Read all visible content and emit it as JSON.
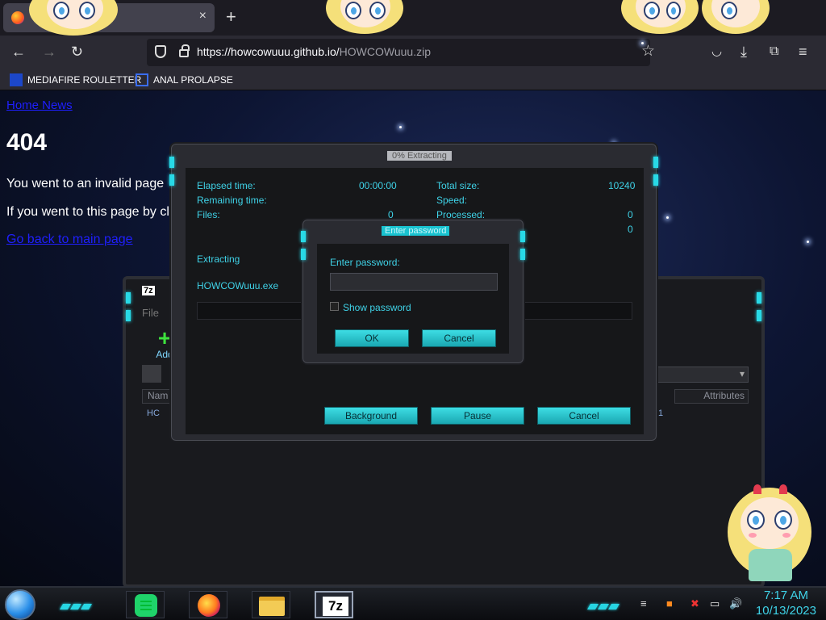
{
  "browser": {
    "tab_close": "×",
    "new_tab": "+",
    "url_main": "https://howcowuuu.github.io/",
    "url_path": "HOWCOWuuu.zip",
    "bookmarks": [
      {
        "label": "MEDIAFIRE ROULETTER",
        "icon_text": "MF\nT"
      },
      {
        "label": "ANAL PROLAPSE"
      }
    ]
  },
  "page": {
    "nav_link": "Home News",
    "heading": "404",
    "line1": "You went to an invalid page",
    "line2": "If you went to this page by cl",
    "back_link": "Go back to main page"
  },
  "file_manager": {
    "logo": "7z",
    "menu_file": "File",
    "add_label": "Add",
    "col_name": "Nam",
    "col_attributes": "Attributes",
    "row_prefix": "HC",
    "row_value": "1"
  },
  "progress": {
    "title": "0% Extracting",
    "elapsed_label": "Elapsed time:",
    "elapsed_value": "00:00:00",
    "remaining_label": "Remaining time:",
    "files_label": "Files:",
    "files_value": "0",
    "total_label": "Total size:",
    "total_value": "10240",
    "speed_label": "Speed:",
    "processed_label": "Processed:",
    "processed_value": "0",
    "extra_value": "0",
    "status": "Extracting",
    "filename": "HOWCOWuuu.exe",
    "btn_background": "Background",
    "btn_pause": "Pause",
    "btn_cancel": "Cancel"
  },
  "password_dialog": {
    "title": "Enter password",
    "label": "Enter password:",
    "value": "",
    "show_password": "Show password",
    "show_password_checked": false,
    "ok": "OK",
    "cancel": "Cancel"
  },
  "taskbar": {
    "sevenz_label": "7z",
    "time": "7:17 AM",
    "date": "10/13/2023"
  },
  "colors": {
    "accent_cyan": "#3fd3e8",
    "button_cyan": "#2ec9d3",
    "dialog_bg": "#161719",
    "link_blue": "#1f1fff"
  }
}
